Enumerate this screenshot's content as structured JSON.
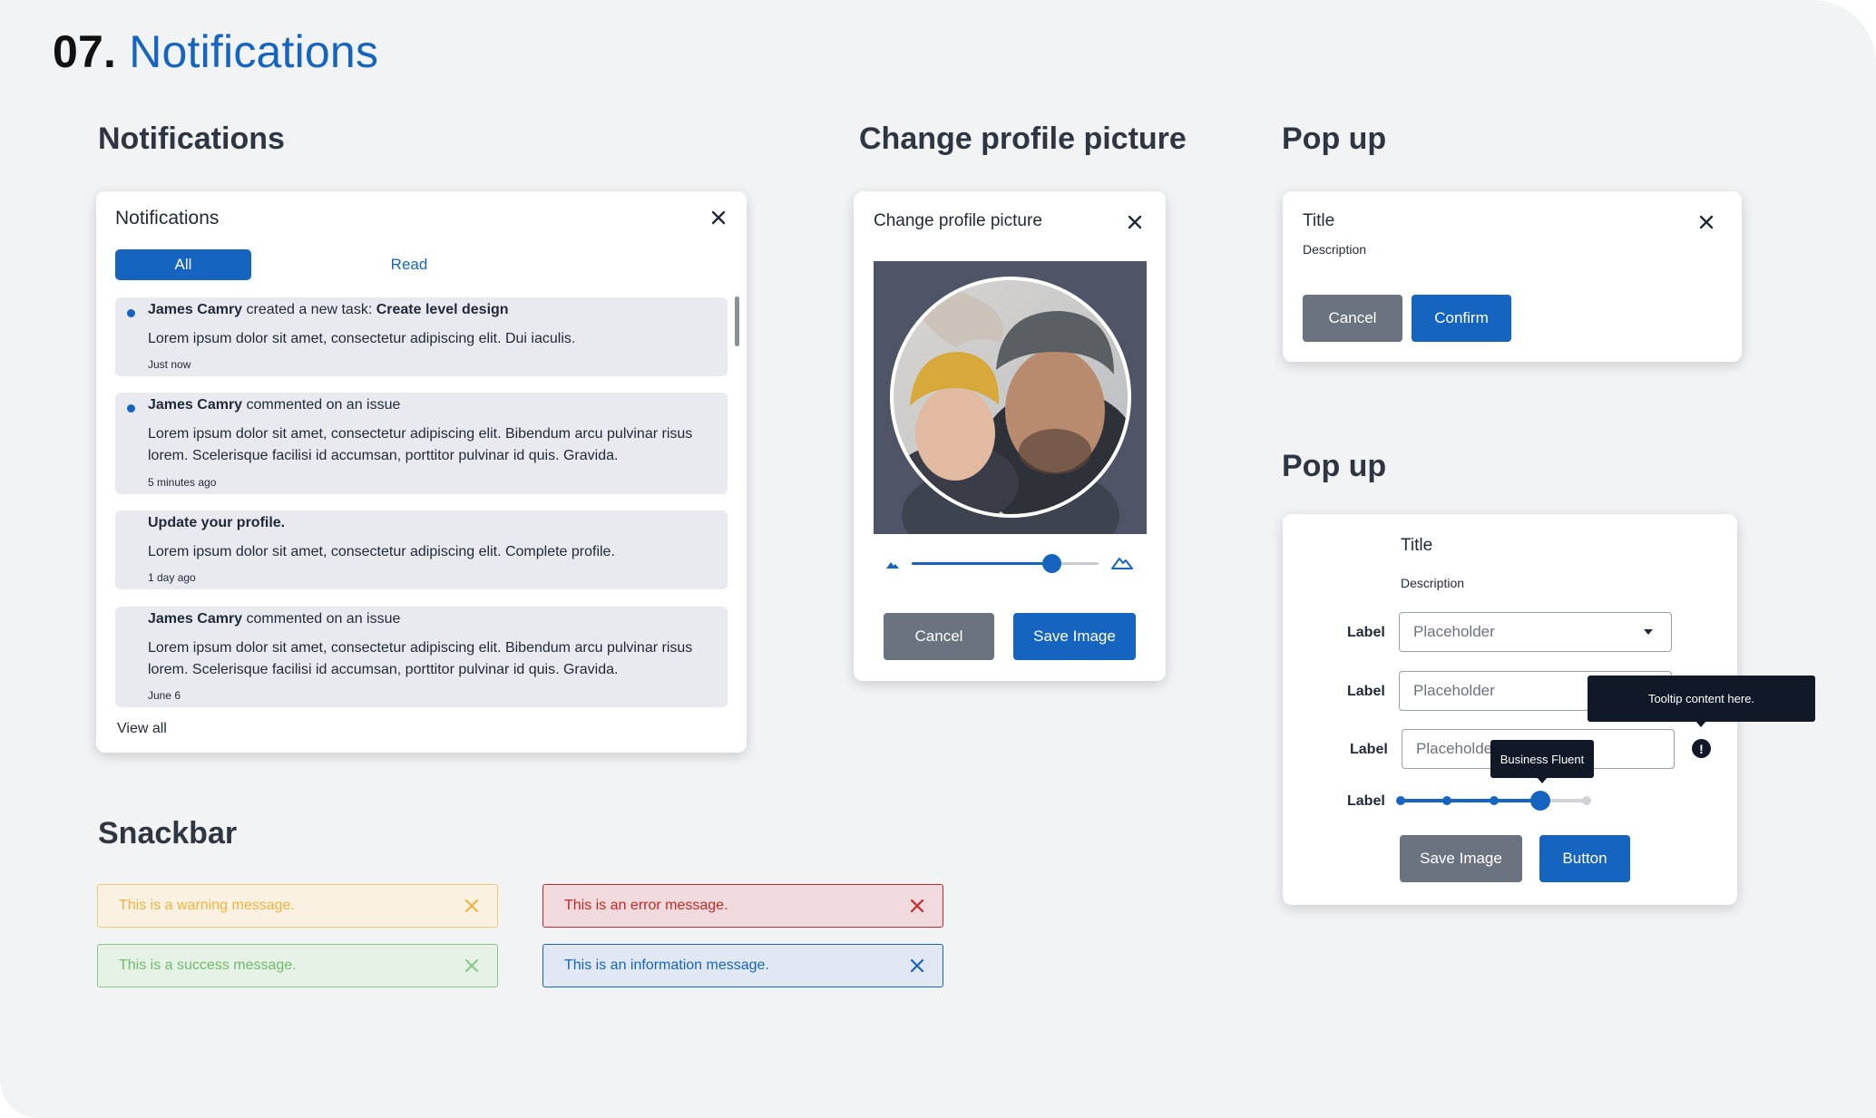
{
  "page": {
    "number": "07.",
    "title": "Notifications",
    "accent_color": "#1565c0"
  },
  "notifications": {
    "section_heading": "Notifications",
    "panel_title": "Notifications",
    "tabs": [
      {
        "label": "All",
        "active": true
      },
      {
        "label": "Read",
        "active": false
      }
    ],
    "items": [
      {
        "unread": true,
        "actor": "James Camry",
        "action": " created a new task: ",
        "target": "Create level design",
        "body": "Lorem ipsum dolor sit amet, consectetur adipiscing elit. Dui iaculis.",
        "time": "Just now"
      },
      {
        "unread": true,
        "actor": "James Camry",
        "action": " commented on an issue",
        "target": "",
        "body": "Lorem ipsum dolor sit amet, consectetur adipiscing elit. Bibendum arcu pulvinar risus lorem. Scelerisque facilisi id accumsan, porttitor pulvinar id quis. Gravida.",
        "time": "5 minutes ago"
      },
      {
        "unread": false,
        "actor": "",
        "action": "",
        "target": "Update your profile.",
        "body": "Lorem ipsum dolor sit amet, consectetur adipiscing elit. Complete profile.",
        "time": "1 day ago"
      },
      {
        "unread": false,
        "actor": "James Camry",
        "action": " commented on an issue",
        "target": "",
        "body": "Lorem ipsum dolor sit amet, consectetur adipiscing elit. Bibendum arcu pulvinar risus lorem. Scelerisque facilisi id accumsan, porttitor pulvinar id quis. Gravida.",
        "time": "June 6"
      }
    ],
    "view_all": "View all"
  },
  "profile_picture": {
    "section_heading": "Change profile picture",
    "dialog_title": "Change profile picture",
    "zoom_level": 0.75,
    "cancel_label": "Cancel",
    "save_label": "Save  Image"
  },
  "popup1": {
    "section_heading": "Pop up",
    "title": "Title",
    "description": "Description",
    "cancel_label": "Cancel",
    "confirm_label": "Confirm"
  },
  "popup2": {
    "section_heading": "Pop up",
    "title": "Title",
    "description": "Description",
    "fields": [
      {
        "label": "Label",
        "type": "select",
        "placeholder": "Placeholder"
      },
      {
        "label": "Label",
        "type": "text",
        "placeholder": "Placeholder"
      },
      {
        "label": "Label",
        "type": "text",
        "placeholder": "Placeholder"
      },
      {
        "label": "Label",
        "type": "slider",
        "value": 0.75,
        "steps": 4
      }
    ],
    "tooltip_text": "Tooltip content here.",
    "slider_tooltip": "Business Fluent",
    "save_label": "Save  Image",
    "button_label": "Button"
  },
  "snackbar": {
    "section_heading": "Snackbar",
    "messages": [
      {
        "type": "warning",
        "text": "This is a warning message.",
        "bg": "#faf1e3",
        "border": "#f3c977",
        "color": "#f0b43c"
      },
      {
        "type": "error",
        "text": "This is an error message.",
        "bg": "#f0dadd",
        "border": "#c62828",
        "color": "#c62828"
      },
      {
        "type": "success",
        "text": "This is a success message.",
        "bg": "#e7f2e6",
        "border": "#8bc68a",
        "color": "#6fbb6c"
      },
      {
        "type": "info",
        "text": "This is an information message.",
        "bg": "#e1e8f3",
        "border": "#1565c0",
        "color": "#1565c0"
      }
    ]
  },
  "icons": {
    "close": "close-icon",
    "dropdown": "caret-down-icon",
    "info": "exclamation-circle-icon",
    "zoom_out": "mountain-small-icon",
    "zoom_in": "mountain-large-icon"
  }
}
